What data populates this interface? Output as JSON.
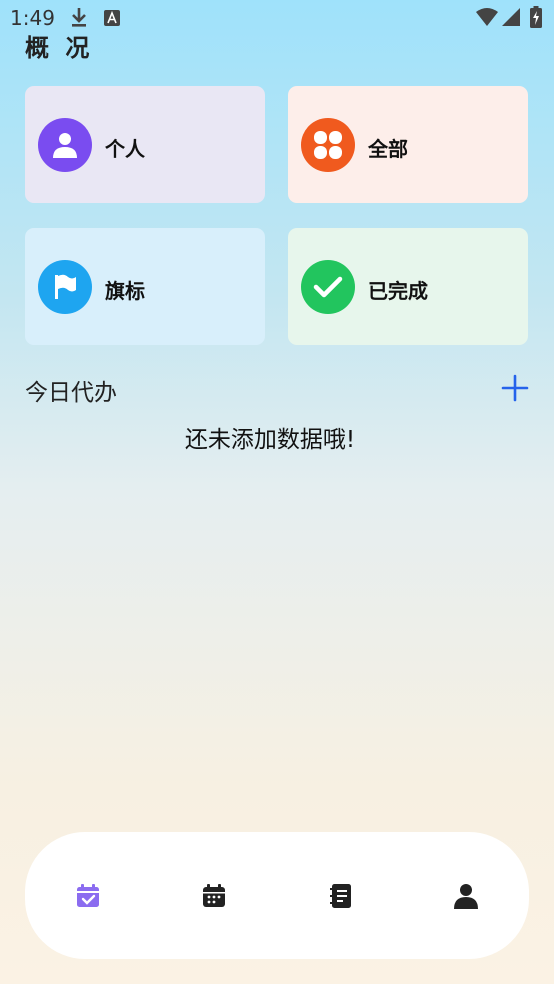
{
  "status": {
    "time": "1:49"
  },
  "page_title": "概 况",
  "cards": [
    {
      "label": "个人",
      "icon": "person-icon",
      "color": "#7a4cf0"
    },
    {
      "label": "全部",
      "icon": "grid-icon",
      "color": "#f05a1e"
    },
    {
      "label": "旗标",
      "icon": "flag-icon",
      "color": "#1ea5f0"
    },
    {
      "label": "已完成",
      "icon": "check-icon",
      "color": "#22c55e"
    }
  ],
  "todo": {
    "title": "今日代办",
    "empty_text": "还未添加数据哦!"
  },
  "tabbar": {
    "tabs": [
      {
        "icon": "calendar-check-icon",
        "active": true,
        "color": "#8b6cf0"
      },
      {
        "icon": "calendar-icon",
        "active": false,
        "color": "#222222"
      },
      {
        "icon": "notebook-icon",
        "active": false,
        "color": "#222222"
      },
      {
        "icon": "user-icon",
        "active": false,
        "color": "#222222"
      }
    ]
  },
  "colors": {
    "accent": "#2563eb"
  }
}
